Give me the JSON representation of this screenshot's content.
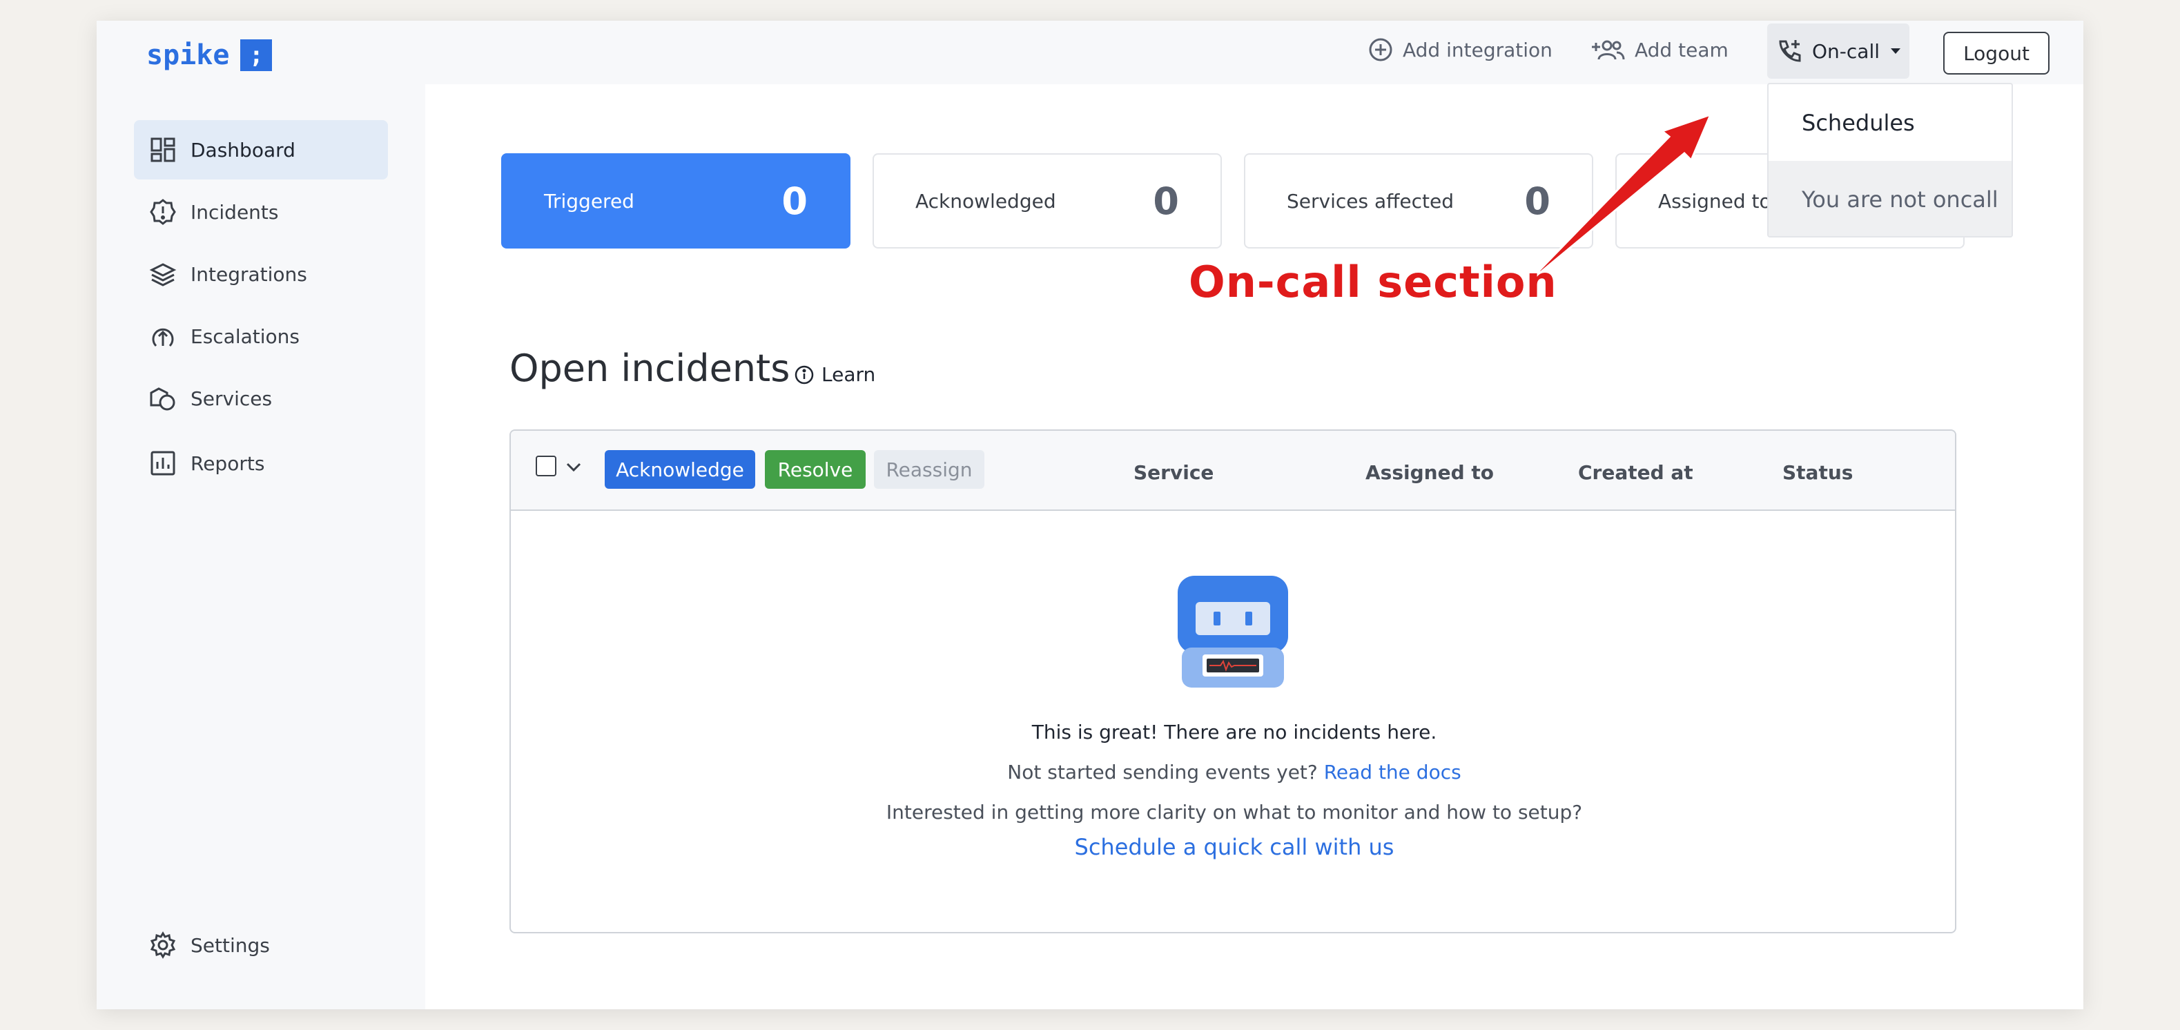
{
  "app": {
    "logo_text": "spike",
    "logo_glyph": ";",
    "brand_color": "#2c6fe0"
  },
  "sidebar": {
    "items": [
      {
        "label": "Dashboard",
        "icon": "dashboard-icon",
        "active": true
      },
      {
        "label": "Incidents",
        "icon": "alert-icon"
      },
      {
        "label": "Integrations",
        "icon": "layers-icon"
      },
      {
        "label": "Escalations",
        "icon": "escalation-icon"
      },
      {
        "label": "Services",
        "icon": "shapes-icon"
      },
      {
        "label": "Reports",
        "icon": "chart-icon"
      }
    ],
    "settings_label": "Settings"
  },
  "topbar": {
    "add_integration": "Add integration",
    "add_team": "Add team",
    "oncall": "On-call",
    "logout": "Logout"
  },
  "dropdown": {
    "schedules": "Schedules",
    "not_oncall": "You are not oncall"
  },
  "stats": [
    {
      "label": "Triggered",
      "value": "0"
    },
    {
      "label": "Acknowledged",
      "value": "0"
    },
    {
      "label": "Services affected",
      "value": "0"
    },
    {
      "label": "Assigned to",
      "value": ""
    }
  ],
  "incidents": {
    "title": "Open incidents",
    "learn": "Learn",
    "actions": {
      "acknowledge": "Acknowledge",
      "resolve": "Resolve",
      "reassign": "Reassign"
    },
    "columns": [
      "Service",
      "Assigned to",
      "Created at",
      "Status"
    ],
    "empty": {
      "line1": "This is great! There are no incidents here.",
      "line2_prefix": "Not started sending events yet? ",
      "line2_link": "Read the docs",
      "line3": "Interested in getting more clarity on what to monitor and how to setup?",
      "line4_link": "Schedule a quick call with us"
    }
  },
  "annotation": {
    "text": "On-call section",
    "color": "#e01b1b"
  }
}
